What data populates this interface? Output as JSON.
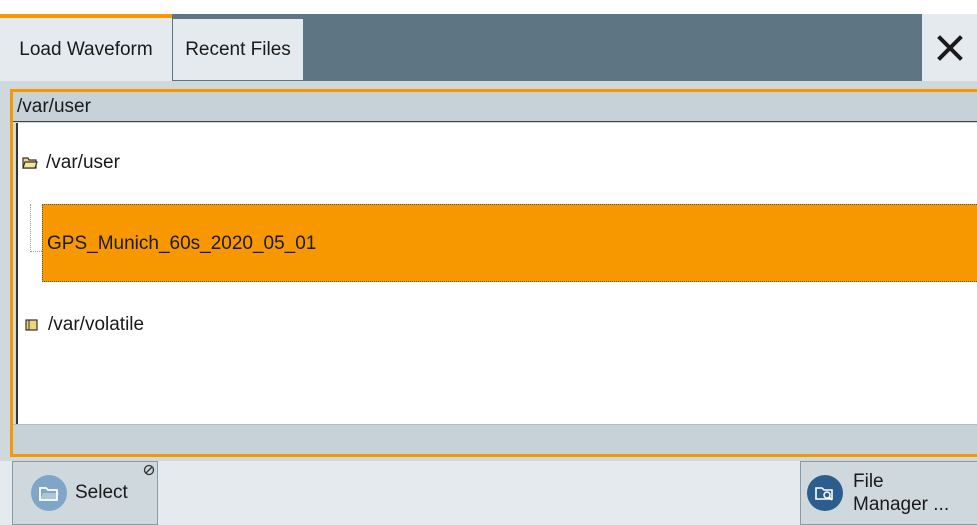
{
  "tabs": [
    {
      "label": "Load Waveform",
      "active": true
    },
    {
      "label": "Recent Files",
      "active": false
    }
  ],
  "close_icon": "close-icon",
  "path_header": "/var/user",
  "tree": {
    "folders": [
      {
        "label": "/var/user",
        "expanded": true,
        "icon": "folder-open-icon"
      },
      {
        "label": "/var/volatile",
        "expanded": false,
        "icon": "folder-icon"
      }
    ],
    "files": [
      {
        "label": "GPS_Munich_60s_2020_05_01",
        "selected": true
      }
    ]
  },
  "toolbar": {
    "select_label": "Select",
    "file_manager_line1": "File",
    "file_manager_line2": "Manager ..."
  },
  "colors": {
    "accent": "#f79800",
    "tabbar": "#5e7684",
    "panel": "#cfd8dd"
  }
}
